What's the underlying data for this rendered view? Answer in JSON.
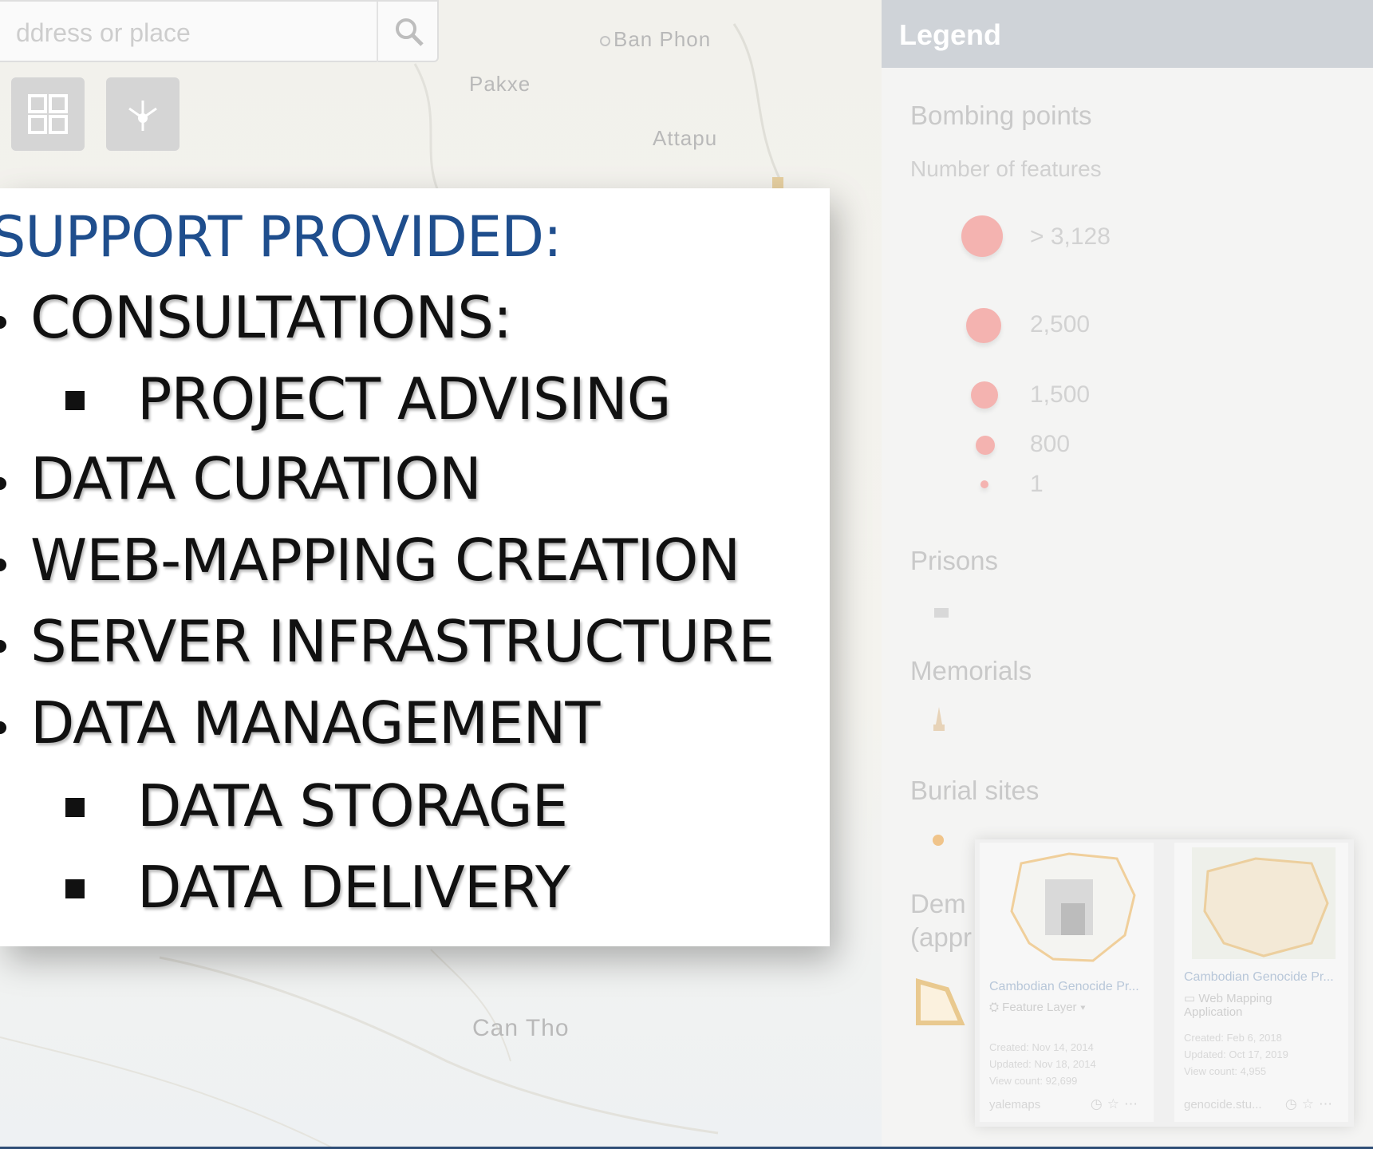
{
  "map": {
    "places": [
      "Ban Phon",
      "Pakxe",
      "Attapu",
      "Can Tho"
    ]
  },
  "search": {
    "placeholder": "ddress or place"
  },
  "toolbar": {
    "search_icon": "search-icon",
    "basemap_icon": "basemap-gallery-icon",
    "share_icon": "share-icon"
  },
  "legend": {
    "header": "Legend",
    "layers": [
      {
        "title": "Bombing points",
        "subtitle": "Number of features",
        "classes": [
          "> 3,128",
          "2,500",
          "1,500",
          "800",
          "1"
        ]
      },
      {
        "title": "Prisons"
      },
      {
        "title": "Memorials"
      },
      {
        "title": "Burial sites"
      },
      {
        "title": "Dem",
        "title_line2": "(appr"
      }
    ]
  },
  "cards": [
    {
      "title": "Cambodian Genocide Pr...",
      "type": "Feature Layer",
      "created": "Created: Nov 14, 2014",
      "updated": "Updated: Nov 18, 2014",
      "views": "View count: 92,699",
      "owner": "yalemaps"
    },
    {
      "title": "Cambodian Genocide Pr...",
      "type": "Web Mapping",
      "type_line2": "Application",
      "created": "Created: Feb 6, 2018",
      "updated": "Updated: Oct 17, 2019",
      "views": "View count: 4,955",
      "owner": "genocide.stu..."
    }
  ],
  "slide": {
    "heading": "SUPPORT PROVIDED:",
    "items": [
      {
        "level": 1,
        "text": "CONSULTATIONS:"
      },
      {
        "level": 2,
        "text": "PROJECT ADVISING"
      },
      {
        "level": 1,
        "text": "DATA CURATION"
      },
      {
        "level": 1,
        "text": "WEB-MAPPING CREATION"
      },
      {
        "level": 1,
        "text": "SERVER INFRASTRUCTURE"
      },
      {
        "level": 1,
        "text": "DATA MANAGEMENT"
      },
      {
        "level": 2,
        "text": "DATA STORAGE"
      },
      {
        "level": 2,
        "text": "DATA DELIVERY"
      }
    ]
  },
  "colors": {
    "heading": "#1f4e8d",
    "legend_header": "#cfd3d8",
    "bombing_point": "#f4b3b0"
  }
}
